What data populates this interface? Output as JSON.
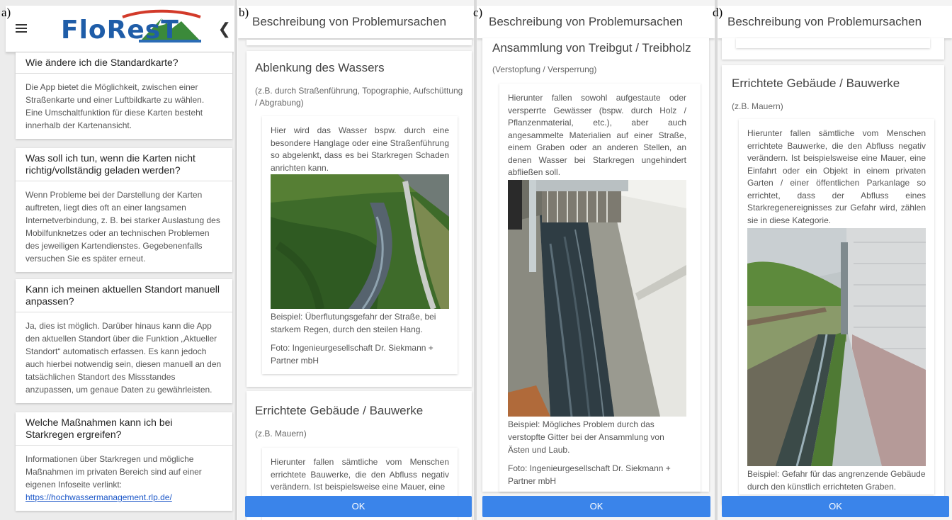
{
  "panel_letters": [
    "a)",
    "b)",
    "c)",
    "d)"
  ],
  "app": {
    "logo_text": "FloResT"
  },
  "faq": [
    {
      "q": "Wie ändere ich die Standardkarte?",
      "a": "Die App bietet die Möglichkeit, zwischen einer Straßenkarte und einer Luftbildkarte zu wählen. Eine Umschaltfunktion für diese Karten besteht innerhalb der Kartenansicht."
    },
    {
      "q": "Was soll ich tun, wenn die Karten nicht richtig/vollständig geladen werden?",
      "a": "Wenn Probleme bei der Darstellung der Karten auftreten, liegt dies oft an einer langsamen Internetverbindung, z. B. bei starker Auslastung des Mobilfunknetzes oder an technischen Problemen des jeweiligen Kartendienstes. Gegebenenfalls versuchen Sie es später erneut."
    },
    {
      "q": "Kann ich meinen aktuellen Standort manuell anpassen?",
      "a": "Ja, dies ist möglich. Darüber hinaus kann die App den aktuellen Standort über die Funktion „Aktueller Standort“ automatisch erfassen. Es kann jedoch auch hierbei notwendig sein, diesen manuell an den tatsächlichen Standort des Missstandes anzupassen, um genaue Daten zu gewährleisten."
    },
    {
      "q": "Welche Maßnahmen kann ich bei Starkregen ergreifen?",
      "a": "Informationen über Starkregen und mögliche Maßnahmen im privaten Bereich sind auf einer eigenen Infoseite verlinkt:",
      "link": "https://hochwassermanagement.rlp.de/"
    }
  ],
  "header_title": "Beschreibung von Problemursachen",
  "ok_label": "OK",
  "panel_b": {
    "title1": "Ablenkung des Wassers",
    "sub1": "(z.B. durch Straßenführung, Topographie, Aufschüttung / Abgrabung)",
    "text1": "Hier wird das Wasser bspw. durch eine besondere Hanglage oder eine Straßenführung so abgelenkt, dass es bei Starkregen Schaden anrichten kann.",
    "caption1": "Beispiel: Überflutungsgefahr der Straße, bei starkem Regen, durch den steilen Hang.",
    "credit1": "Foto: Ingenieurgesellschaft Dr. Siekmann + Partner mbH",
    "title2": "Errichtete Gebäude / Bauwerke",
    "sub2": "(z.B. Mauern)",
    "text2": "Hierunter fallen sämtliche vom Menschen errichtete Bauwerke, die den Abfluss negativ verändern. Ist beispielsweise eine Mauer, eine"
  },
  "panel_c": {
    "title": "Ansammlung von Treibgut / Treibholz",
    "sub": "(Verstopfung / Versperrung)",
    "text": "Hierunter fallen sowohl aufgestaute oder versperrte Gewässer (bspw. durch Holz / Pflanzenmaterial, etc.), aber auch angesammelte Materialien auf einer Straße, einem Graben oder an anderen Stellen, an denen Wasser bei Starkregen ungehindert abfließen soll.",
    "caption": "Beispiel: Mögliches Problem durch das verstopfte Gitter bei der Ansammlung von Ästen und Laub.",
    "credit": "Foto: Ingenieurgesellschaft Dr. Siekmann + Partner mbH"
  },
  "panel_d": {
    "title": "Errichtete Gebäude / Bauwerke",
    "sub": "(z.B. Mauern)",
    "text": "Hierunter fallen sämtliche vom Menschen errichtete Bauwerke, die den Abfluss negativ verändern. Ist beispielsweise eine Mauer, eine Einfahrt oder ein Objekt in einem privaten Garten / einer öffentlichen Parkanlage so errichtet, dass der Abfluss eines Starkregenereignisses zur Gefahr wird, zählen sie in diese Kategorie.",
    "caption": "Beispiel: Gefahr für das angrenzende Gebäude durch den künstlich errichteten Graben."
  }
}
